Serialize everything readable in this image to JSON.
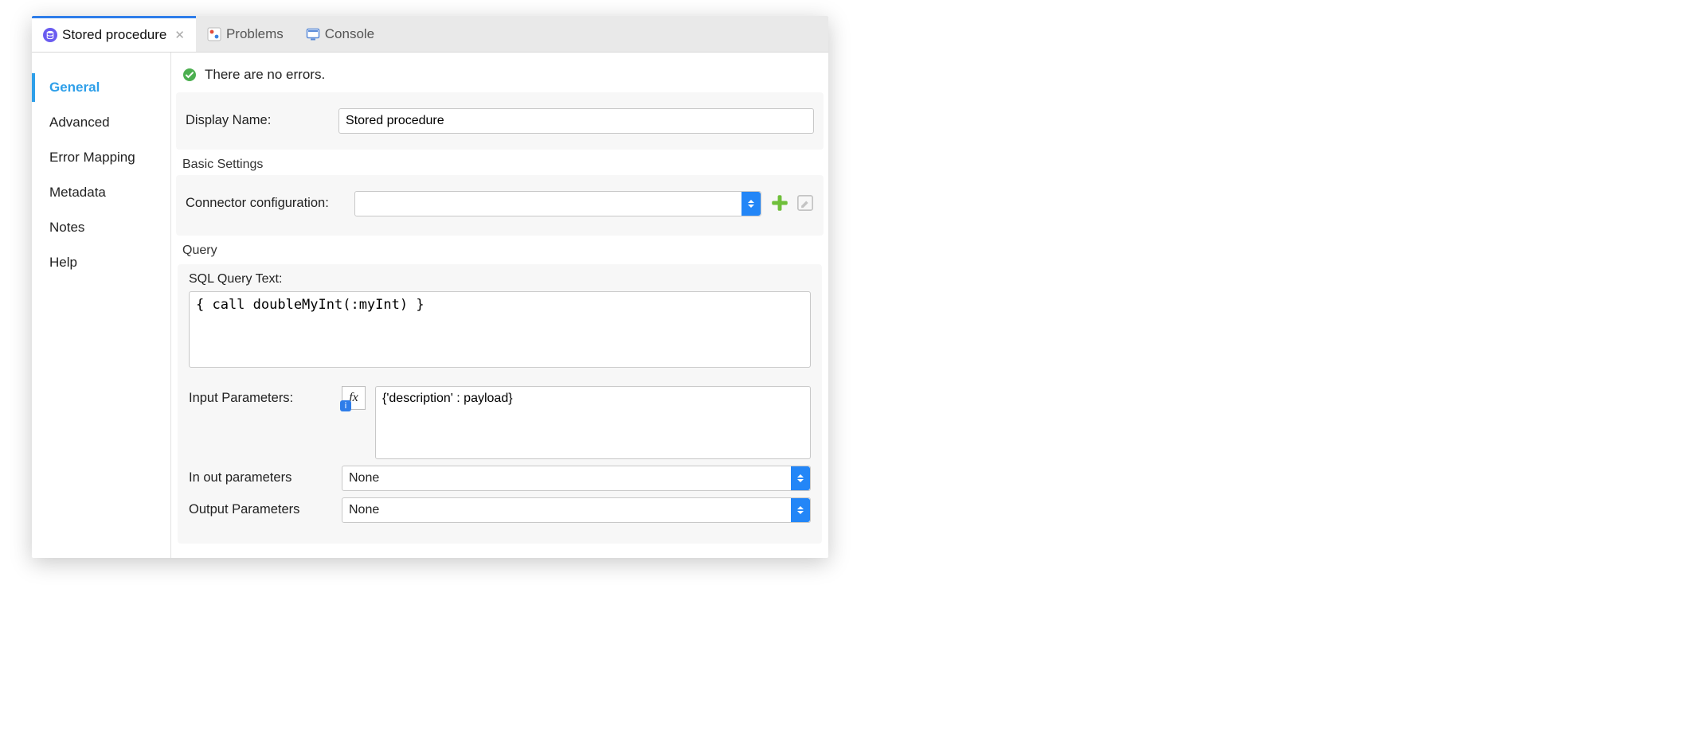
{
  "tabs": {
    "active": {
      "label": "Stored procedure"
    },
    "problems": {
      "label": "Problems"
    },
    "console": {
      "label": "Console"
    }
  },
  "sidebar": {
    "items": [
      {
        "label": "General",
        "active": true
      },
      {
        "label": "Advanced"
      },
      {
        "label": "Error Mapping"
      },
      {
        "label": "Metadata"
      },
      {
        "label": "Notes"
      },
      {
        "label": "Help"
      }
    ]
  },
  "status": {
    "message": "There are no errors."
  },
  "form": {
    "display_name_label": "Display Name:",
    "display_name_value": "Stored procedure",
    "basic_settings_title": "Basic Settings",
    "connector_config_label": "Connector configuration:",
    "connector_config_value": "",
    "query_title": "Query",
    "sql_text_label": "SQL Query Text:",
    "sql_text_value": "{ call doubleMyInt(:myInt) }",
    "input_params_label": "Input Parameters:",
    "fx_label": "fx",
    "input_params_value": "{'description' : payload}",
    "inout_label": "In out parameters",
    "inout_value": "None",
    "output_label": "Output Parameters",
    "output_value": "None"
  }
}
